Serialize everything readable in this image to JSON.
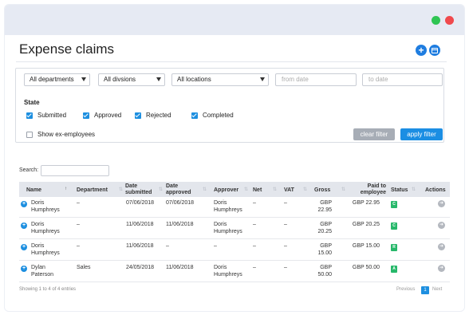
{
  "window": {
    "controls": [
      "maximize",
      "close"
    ]
  },
  "page": {
    "title": "Expense claims",
    "add_icon": "plus-icon",
    "calendar_icon": "calendar-icon"
  },
  "filters": {
    "department": "All departments",
    "division": "All divsions",
    "location": "All locations",
    "from_date_placeholder": "from date",
    "to_date_placeholder": "to date",
    "state_label": "State",
    "states": [
      {
        "label": "Submitted",
        "checked": true
      },
      {
        "label": "Approved",
        "checked": true
      },
      {
        "label": "Rejected",
        "checked": true
      },
      {
        "label": "Completed",
        "checked": true
      }
    ],
    "show_ex_employees": {
      "label": "Show ex-employees",
      "checked": false
    },
    "clear_label": "clear filter",
    "apply_label": "apply filter"
  },
  "search": {
    "label": "Search:",
    "value": ""
  },
  "table": {
    "headers": {
      "name": "Name",
      "department": "Department",
      "date_submitted": "Date submitted",
      "date_approved": "Date approved",
      "approver": "Approver",
      "net": "Net",
      "vat": "VAT",
      "gross": "Gross",
      "paid": "Paid to employee",
      "status": "Status",
      "actions": "Actions"
    },
    "rows": [
      {
        "name": "Doris Humphreys",
        "department": "–",
        "date_submitted": "07/06/2018",
        "date_approved": "07/06/2018",
        "approver": "Doris Humphreys",
        "net": "–",
        "vat": "–",
        "gross": "GBP 22.95",
        "paid": "GBP 22.95",
        "status": "C"
      },
      {
        "name": "Doris Humphreys",
        "department": "–",
        "date_submitted": "11/06/2018",
        "date_approved": "11/06/2018",
        "approver": "Doris Humphreys",
        "net": "–",
        "vat": "–",
        "gross": "GBP 20.25",
        "paid": "GBP 20.25",
        "status": "C"
      },
      {
        "name": "Doris Humphreys",
        "department": "–",
        "date_submitted": "11/06/2018",
        "date_approved": "–",
        "approver": "–",
        "net": "–",
        "vat": "–",
        "gross": "GBP 15.00",
        "paid": "GBP 15.00",
        "status": "R"
      },
      {
        "name": "Dylan Paterson",
        "department": "Sales",
        "date_submitted": "24/05/2018",
        "date_approved": "11/06/2018",
        "approver": "Doris Humphreys",
        "net": "–",
        "vat": "–",
        "gross": "GBP 50.00",
        "paid": "GBP 50.00",
        "status": "A"
      }
    ]
  },
  "footer": {
    "info": "Showing 1 to 4 of 4 entries",
    "previous": "Previous",
    "current_page": "1",
    "next": "Next"
  },
  "colors": {
    "accent": "#1d8fe0",
    "status_green": "#27b86a",
    "clear_button": "#a7adb6"
  }
}
